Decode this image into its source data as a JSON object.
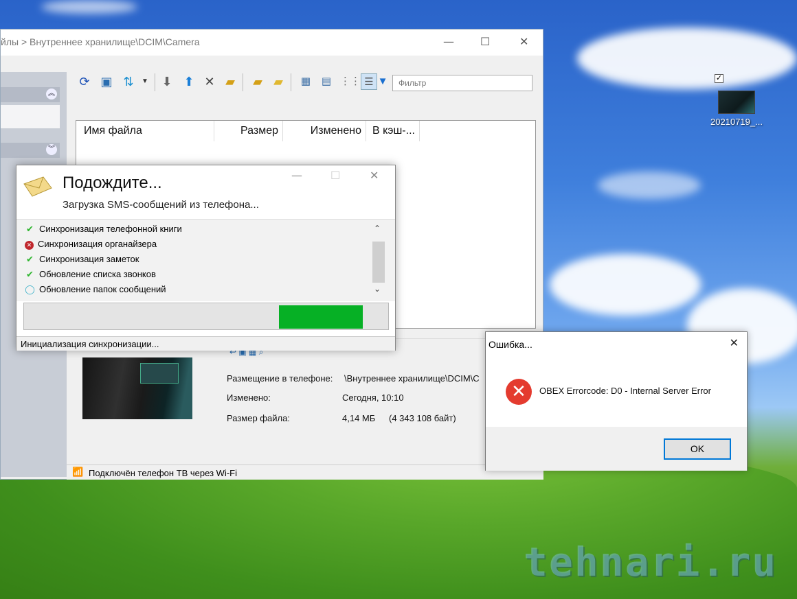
{
  "desktop": {
    "icon_label": "20210719_...",
    "watermark": "tehnari.ru"
  },
  "main_window": {
    "title": "йлы > Внутреннее хранилище\\DCIM\\Camera",
    "filter_placeholder": "Фильтр",
    "columns": [
      "Имя файла",
      "Размер",
      "Изменено",
      "В кэш-..."
    ],
    "info": {
      "location_label": "Размещение в телефоне:",
      "location_value": "\\Внутреннее хранилище\\DCIM\\C",
      "modified_label": "Изменено:",
      "modified_value": "Сегодня, 10:10",
      "size_label": "Размер файла:",
      "size_value": "4,14 МБ",
      "size_bytes": "(4 343 108 байт)"
    },
    "status": "Подключён телефон ТВ через Wi-Fi"
  },
  "wait_dialog": {
    "title": "Подождите...",
    "subtitle": "Загрузка SMS-сообщений из телефона...",
    "tasks": [
      {
        "label": "Синхронизация телефонной книги",
        "state": "ok"
      },
      {
        "label": "Синхронизация органайзера",
        "state": "error"
      },
      {
        "label": "Синхронизация заметок",
        "state": "ok"
      },
      {
        "label": "Обновление списка звонков",
        "state": "ok"
      },
      {
        "label": "Обновление папок сообщений",
        "state": "in-progress"
      }
    ],
    "progress_segment": [
      0.7,
      0.93
    ],
    "status": "Инициализация синхронизации..."
  },
  "error_dialog": {
    "title": "Ошибка...",
    "message": "OBEX Errorcode: D0 - Internal Server Error",
    "ok_label": "OK"
  },
  "colors": {
    "progress": "#06b025",
    "error_icon": "#e43b2f",
    "ok_check": "#2db52d",
    "focus_border": "#0078d7"
  }
}
